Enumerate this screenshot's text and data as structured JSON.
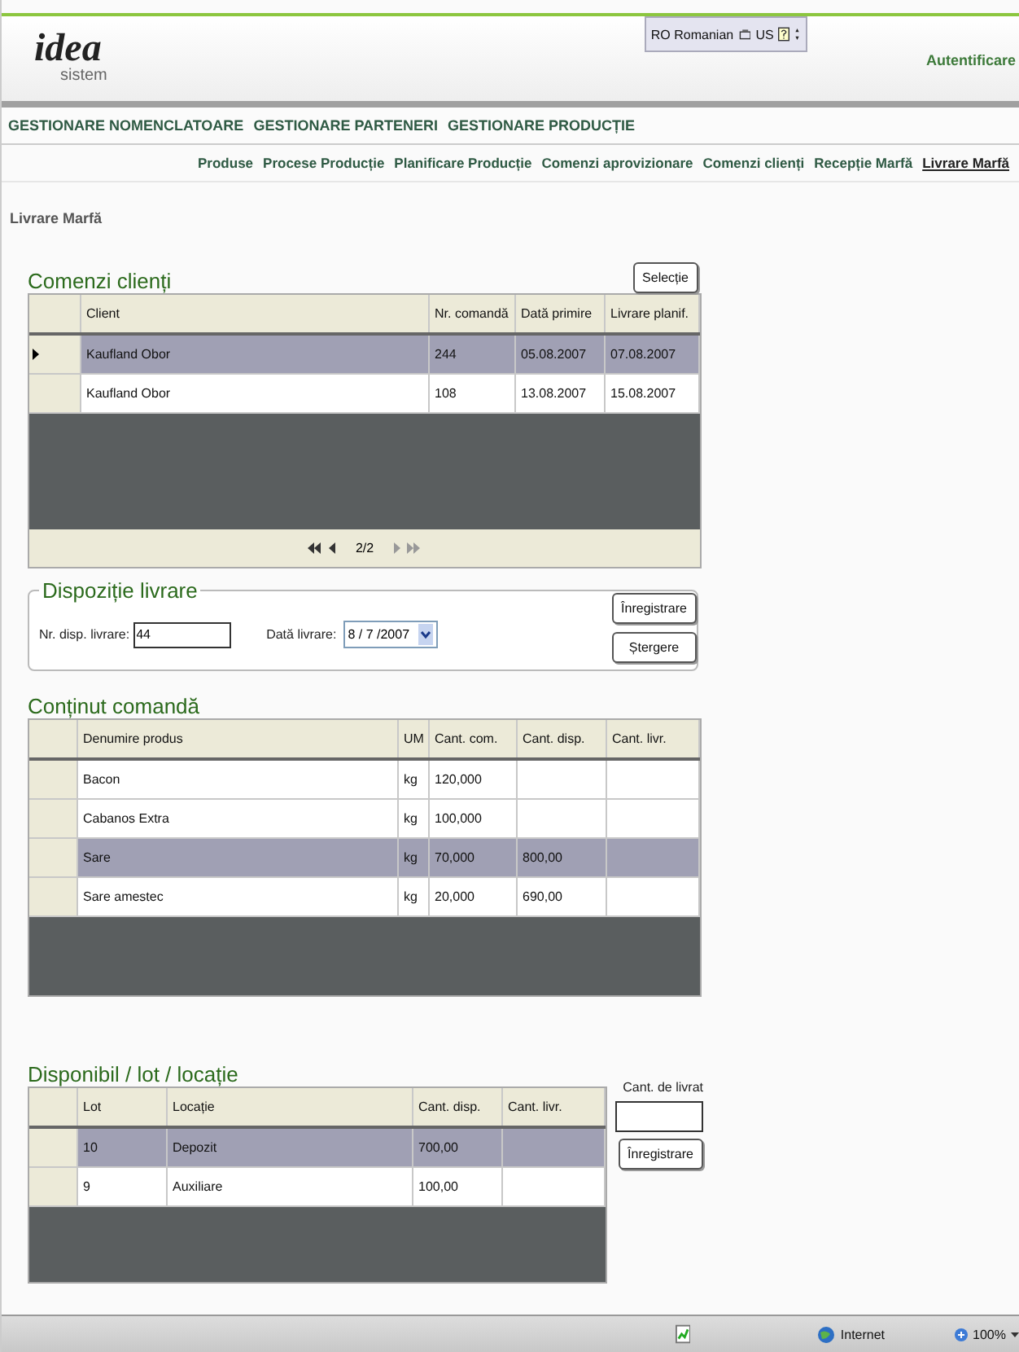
{
  "header": {
    "logo": {
      "main": "idea",
      "sub": "sistem"
    },
    "language_bar": {
      "language": "RO Romanian",
      "keyboard": "US"
    },
    "login_link": "Autentificare"
  },
  "main_menu": [
    {
      "label": "GESTIONARE NOMENCLATOARE",
      "selected": false
    },
    {
      "label": "GESTIONARE PARTENERI",
      "selected": false
    },
    {
      "label": "GESTIONARE PRODUCȚIE",
      "selected": false
    }
  ],
  "sub_menu": [
    {
      "label": "Produse",
      "selected": false
    },
    {
      "label": "Procese Producție",
      "selected": false
    },
    {
      "label": "Planificare Producție",
      "selected": false
    },
    {
      "label": "Comenzi aprovizionare",
      "selected": false
    },
    {
      "label": "Comenzi clienți",
      "selected": false
    },
    {
      "label": "Recepție Marfă",
      "selected": false
    },
    {
      "label": "Livrare Marfă",
      "selected": true
    }
  ],
  "page_title": "Livrare Marfă",
  "orders": {
    "title": "Comenzi clienți",
    "button": "Selecție",
    "columns": [
      "Client",
      "Nr. comandă",
      "Dată primire",
      "Livrare planif."
    ],
    "rows": [
      {
        "cells": [
          "Kaufland Obor",
          "244",
          "05.08.2007",
          "07.08.2007"
        ],
        "selected": true,
        "current": true
      },
      {
        "cells": [
          "Kaufland Obor",
          "108",
          "13.08.2007",
          "15.08.2007"
        ],
        "selected": false,
        "current": false
      }
    ],
    "pager": "2/2"
  },
  "disposition": {
    "legend": "Dispoziție livrare",
    "number_label": "Nr. disp. livrare:",
    "number_value": "44",
    "date_label": "Dată livrare:",
    "date_value": "8 / 7 /2007",
    "buttons": [
      "Înregistrare",
      "Ștergere"
    ]
  },
  "contents": {
    "title": "Conținut comandă",
    "columns": [
      "Denumire produs",
      "UM",
      "Cant. com.",
      "Cant. disp.",
      "Cant. livr."
    ],
    "rows": [
      {
        "cells": [
          "Bacon",
          "kg",
          "120,000",
          "",
          ""
        ],
        "selected": false
      },
      {
        "cells": [
          "Cabanos Extra",
          "kg",
          "100,000",
          "",
          ""
        ],
        "selected": false
      },
      {
        "cells": [
          "Sare",
          "kg",
          "70,000",
          "800,00",
          ""
        ],
        "selected": true
      },
      {
        "cells": [
          "Sare amestec",
          "kg",
          "20,000",
          "690,00",
          ""
        ],
        "selected": false
      }
    ]
  },
  "availability": {
    "title": "Disponibil / lot / locație",
    "columns": [
      "Lot",
      "Locație",
      "Cant. disp.",
      "Cant. livr."
    ],
    "rows": [
      {
        "cells": [
          "10",
          "Depozit",
          "700,00",
          ""
        ],
        "selected": true
      },
      {
        "cells": [
          "9",
          "Auxiliare",
          "100,00",
          ""
        ],
        "selected": false
      }
    ],
    "quantity_label": "Cant. de livrat",
    "button": "Înregistrare"
  },
  "status_bar": {
    "zone": "Internet",
    "zoom": "100%"
  }
}
